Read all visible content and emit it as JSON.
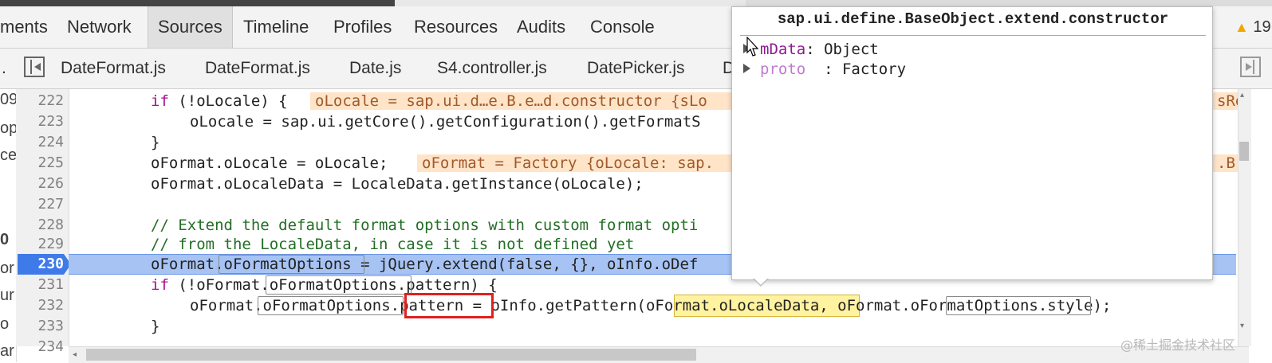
{
  "main_tabs": [
    "ments",
    "Network",
    "Sources",
    "Timeline",
    "Profiles",
    "Resources",
    "Audits",
    "Console"
  ],
  "active_main_tab": "Sources",
  "warning_count": "19",
  "file_tabs": [
    ".",
    "DateFormat.js",
    "DateFormat.js",
    "Date.js",
    "S4.controller.js",
    "DatePicker.js",
    "D"
  ],
  "sidebar_fragments": [
    "09",
    "op",
    "ce",
    "0",
    "or",
    "ur",
    "o",
    "ar"
  ],
  "lines": {
    "n222": "222",
    "n223": "223",
    "n224": "224",
    "n225": "225",
    "n226": "226",
    "n227": "227",
    "n228": "228",
    "n229": "229",
    "n230": "230",
    "n231": "231",
    "n232": "232",
    "n233": "233",
    "n234": "234"
  },
  "code": {
    "l222_kw": "if",
    "l222_rest": " (!oLocale) {",
    "l222_inline": "oLocale = sap.ui.d…e.B.e…d.constructor {sLo",
    "l222_inline_right": "sRe",
    "l223": "oLocale = sap.ui.getCore().getConfiguration().getFormatS",
    "l224": "}",
    "l225": "oFormat.oLocale = oLocale;",
    "l225_inline": "oFormat = Factory {oLocale: sap.",
    "l225_inline_right": ".B.",
    "l226": "oFormat.oLocaleData = LocaleData.getInstance(oLocale);",
    "l228": "// Extend the default format options with custom format opti",
    "l229": "// from the LocaleData, in case it is not defined yet",
    "l230": "oFormat.oFormatOptions = jQuery.extend(false, {}, oInfo.oDef",
    "l231_kw": "if",
    "l231_rest": " (!oFormat.oFormatOptions.pattern) {",
    "l232": "oFormat.oFormatOptions.pattern = oInfo.getPattern(oFormat.oLocaleData, oFormat.oFormatOptions.style);",
    "l233": "}"
  },
  "popover": {
    "title": "sap.ui.define.BaseObject.extend.constructor",
    "row1_key": "mData",
    "row1_val": ": Object",
    "row2_key": "proto",
    "row2_val": "  : Factory"
  },
  "watermark": "@稀土掘金技术社区"
}
